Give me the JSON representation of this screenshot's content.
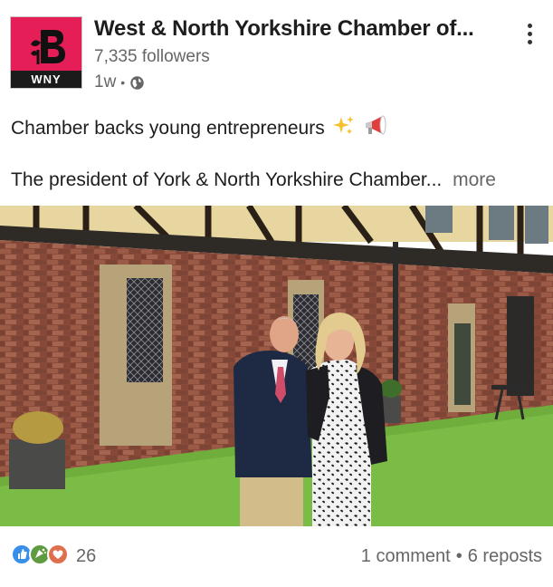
{
  "post": {
    "author": {
      "name": "West & North Yorkshire Chamber of...",
      "followers": "7,335 followers",
      "time": "1w",
      "visibility_icon": "globe-icon",
      "logo_text": "WNY",
      "logo_color": "#e61e57"
    },
    "menu_icon": "more-vertical-icon",
    "text": {
      "headline": "Chamber backs young entrepreneurs",
      "headline_emojis": [
        "sparkles-icon",
        "megaphone-icon"
      ],
      "preview": "The president of York & North Yorkshire Chamber",
      "ellipsis": "...",
      "more_label": "more"
    },
    "image": {
      "icon": "photo-icon"
    },
    "social": {
      "reaction_icons": [
        "like-icon",
        "celebrate-icon",
        "love-icon"
      ],
      "reaction_count": "26",
      "comments": "1 comment",
      "separator": "•",
      "reposts": "6 reposts"
    }
  }
}
